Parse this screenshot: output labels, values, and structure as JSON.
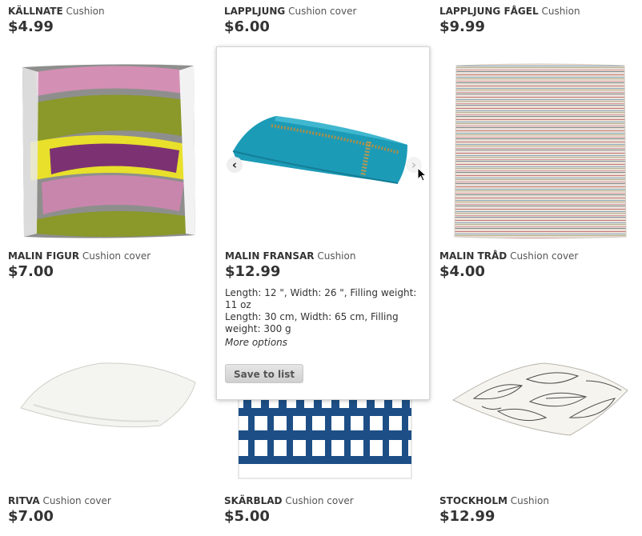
{
  "products": [
    {
      "name": "KÄLLNATE",
      "type": "Cushion",
      "price": "$4.99"
    },
    {
      "name": "LAPPLJUNG",
      "type": "Cushion cover",
      "price": "$6.00"
    },
    {
      "name": "LAPPLJUNG FÅGEL",
      "type": "Cushion",
      "price": "$9.99"
    },
    {
      "name": "MALIN FIGUR",
      "type": "Cushion cover",
      "price": "$7.00"
    },
    {
      "name": "MALIN FRANSAR",
      "type": "Cushion",
      "price": "$12.99"
    },
    {
      "name": "MALIN TRÅD",
      "type": "Cushion cover",
      "price": "$4.00"
    },
    {
      "name": "RITVA",
      "type": "Cushion cover",
      "price": "$7.00"
    },
    {
      "name": "SKÄRBLAD",
      "type": "Cushion cover",
      "price": "$5.00"
    },
    {
      "name": "STOCKHOLM",
      "type": "Cushion",
      "price": "$12.99"
    }
  ],
  "popup": {
    "desc_imperial": "Length: 12 \", Width: 26 \", Filling weight: 11 oz",
    "desc_metric": "Length: 30 cm, Width: 65 cm, Filling weight: 300 g",
    "more_options": "More options",
    "save_label": "Save to list",
    "prev_icon": "chevron-left-icon",
    "next_icon": "chevron-right-icon"
  }
}
